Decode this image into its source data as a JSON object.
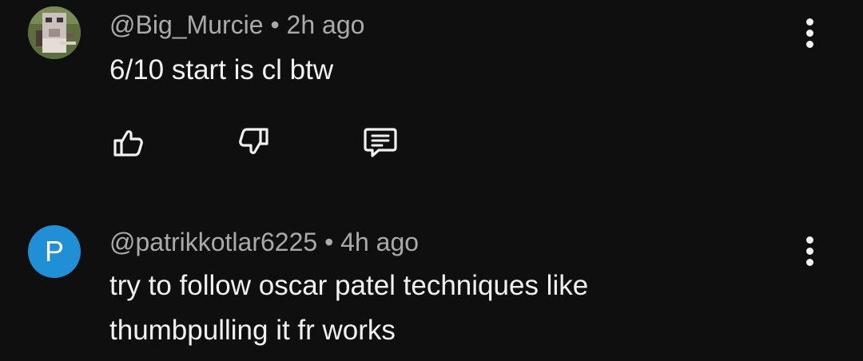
{
  "comments": [
    {
      "author": "@Big_Murcie",
      "time": "2h ago",
      "separator": "•",
      "lines": [
        "6/10 start is cl btw"
      ],
      "avatar_letter": "",
      "actions": [
        "like",
        "dislike",
        "reply"
      ]
    },
    {
      "author": "@patrikkotlar6225",
      "time": "4h ago",
      "separator": "•",
      "lines": [
        "try to follow oscar patel techniques like",
        "thumbpulling it fr works"
      ],
      "avatar_letter": "P",
      "avatar_color": "#1f8fd6"
    }
  ],
  "icons": {
    "like": "thumbs-up-icon",
    "dislike": "thumbs-down-icon",
    "reply": "reply-icon",
    "menu": "more-vert-icon"
  },
  "colors": {
    "background": "#0f0f0f",
    "text_primary": "#f1f1f1",
    "text_secondary": "#aaaaaa"
  }
}
